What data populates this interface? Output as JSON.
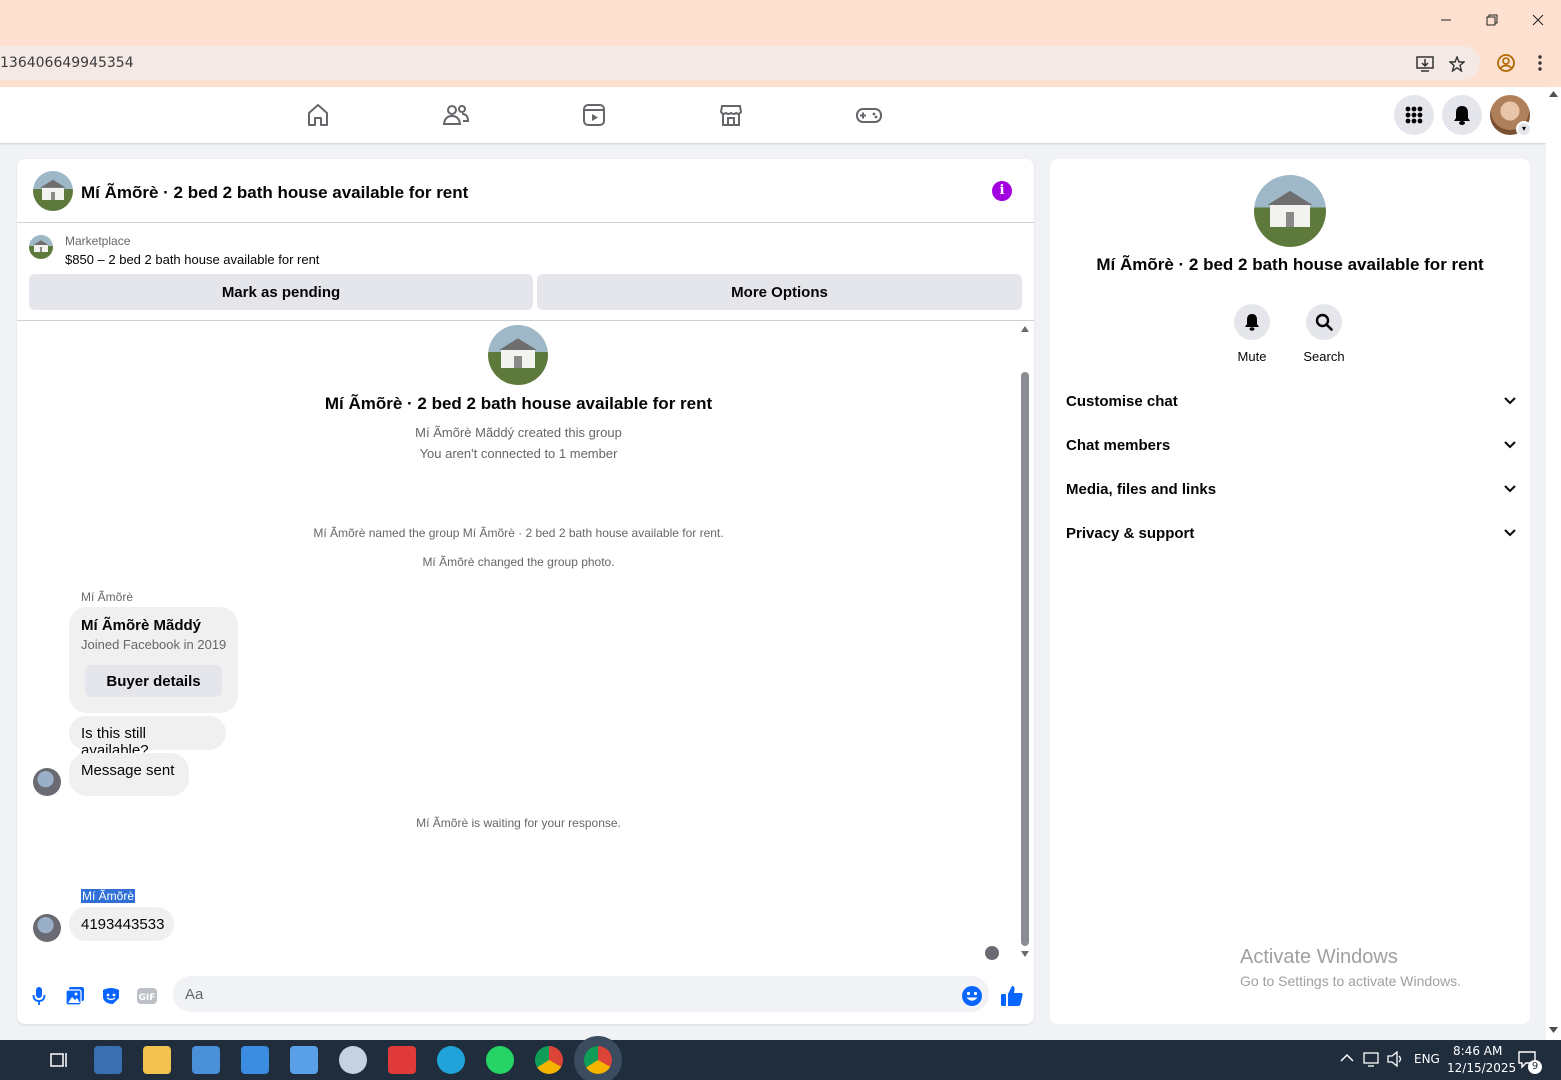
{
  "browser": {
    "url_fragment": "136406649945354"
  },
  "chat": {
    "title": "Mí Ãmõrè · 2 bed 2 bath house available for rent",
    "listing": {
      "label": "Marketplace",
      "description": "$850 – 2 bed 2 bath house available for rent",
      "pending_button": "Mark as pending",
      "options_button": "More Options"
    },
    "intro": {
      "title": "Mí Ãmõrè · 2 bed 2 bath house available for rent",
      "created": "Mí Ãmõrè Mãddý created this group",
      "connection": "You aren't connected to 1 member"
    },
    "events": [
      "Mí Ãmõrè named the group Mí Ãmõrè · 2 bed 2 bath house available for rent.",
      "Mí Ãmõrè changed the group photo."
    ],
    "card": {
      "sender": "Mí Ãmõrè",
      "name": "Mí Ãmõrè Mãddý",
      "joined": "Joined Facebook in 2019",
      "button": "Buyer details"
    },
    "messages": [
      "Is this still available?",
      "Message sent"
    ],
    "waiting": "Mí Ãmõrè is waiting for your response.",
    "last_sender": "Mí Ãmõrè",
    "last_message": "4193443533",
    "composer_placeholder": "Aa"
  },
  "sidebar": {
    "title": "Mí Ãmõrè · 2 bed 2 bath house available for rent",
    "actions": [
      "Mute",
      "Search"
    ],
    "sections": [
      "Customise chat",
      "Chat members",
      "Media, files and links",
      "Privacy & support"
    ],
    "watermark_title": "Activate Windows",
    "watermark_sub": "Go to Settings to activate Windows."
  },
  "taskbar": {
    "language": "ENG",
    "time": "8:46 AM",
    "date": "12/15/2025",
    "notifications": "9"
  },
  "colors": {
    "accent": "#0866ff",
    "info": "#a200e0",
    "chrome": "#fde0cf",
    "taskbar": "#1f2d3d"
  }
}
